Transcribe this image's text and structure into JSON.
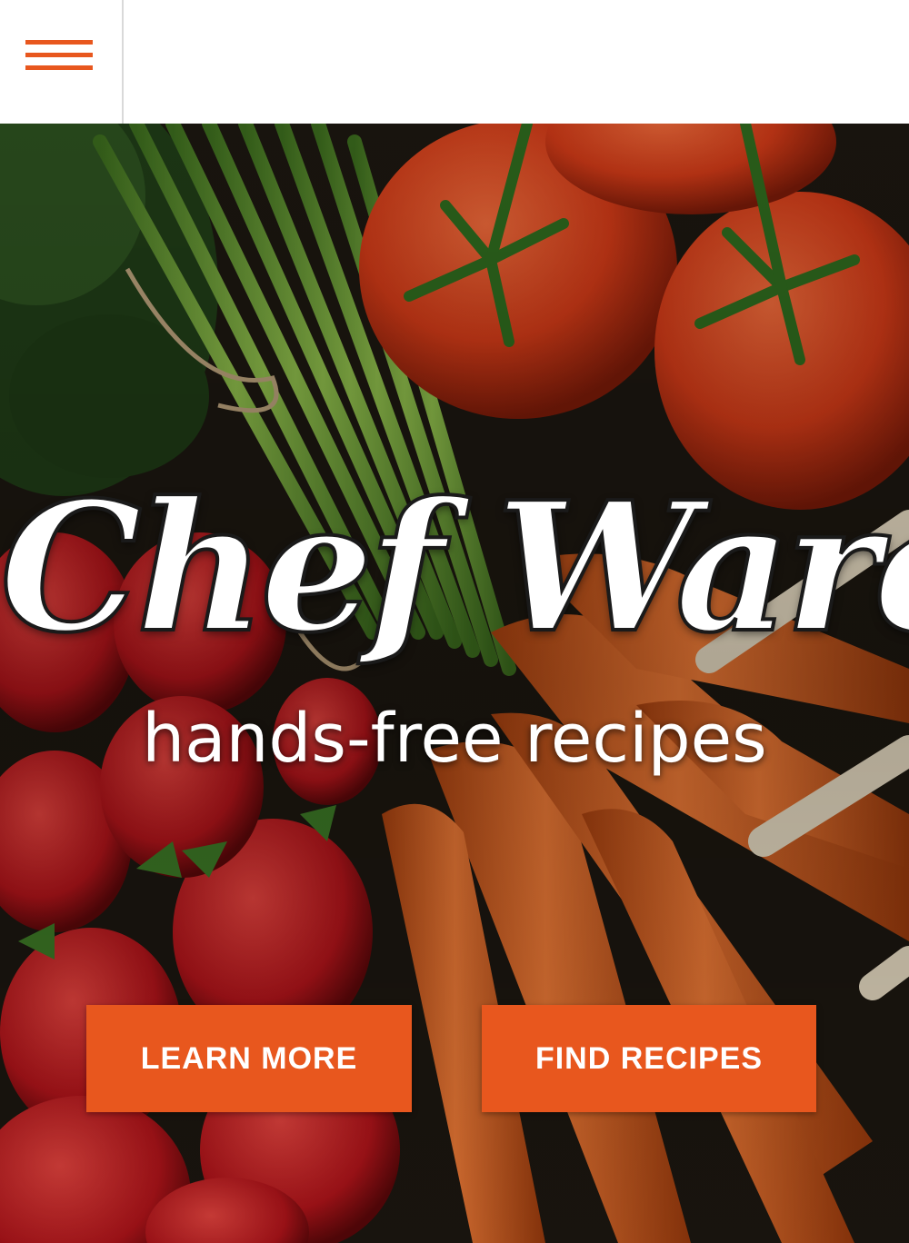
{
  "brand": {
    "title": "Chef Ware",
    "tagline": "hands-free recipes"
  },
  "nav": {
    "menu_icon": "hamburger-menu-icon",
    "accent_color": "#e8571e"
  },
  "hero": {
    "background": "fresh-vegetables-photo",
    "buttons": {
      "learn_more": "LEARN MORE",
      "find_recipes": "FIND RECIPES"
    },
    "button_color": "#e8571e"
  }
}
